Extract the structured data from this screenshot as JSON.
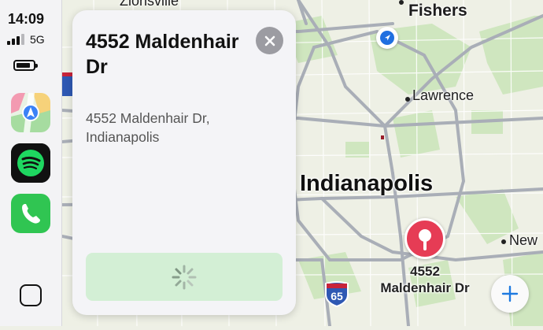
{
  "status": {
    "time": "14:09",
    "network": "5G",
    "signal_bars": 3,
    "battery_level": 0.85
  },
  "sidebar": {
    "apps": [
      {
        "name": "Maps",
        "icon": "maps-icon"
      },
      {
        "name": "Spotify",
        "icon": "spotify-icon"
      },
      {
        "name": "Phone",
        "icon": "phone-icon"
      }
    ],
    "home_icon": "home-square-icon"
  },
  "card": {
    "title": "4552 Maldenhair Dr",
    "address_line1": "4552 Maldenhair Dr,",
    "address_line2": "Indianapolis",
    "close_icon": "close-icon",
    "action_icon": "loading-spinner-icon",
    "action_color": "#d3efd5"
  },
  "map": {
    "labels": {
      "zionsville": "Zionsville",
      "fishers": "Fishers",
      "lawrence": "Lawrence",
      "indianapolis": "Indianapolis",
      "new": "New"
    },
    "shields": {
      "i65": "65",
      "i_left": "I"
    },
    "pin": {
      "label_line1": "4552",
      "label_line2": "Maldenhair Dr",
      "color": "#e63c55"
    },
    "zoom_icon": "plus-icon",
    "location_icon": "navigation-arrow-icon"
  }
}
